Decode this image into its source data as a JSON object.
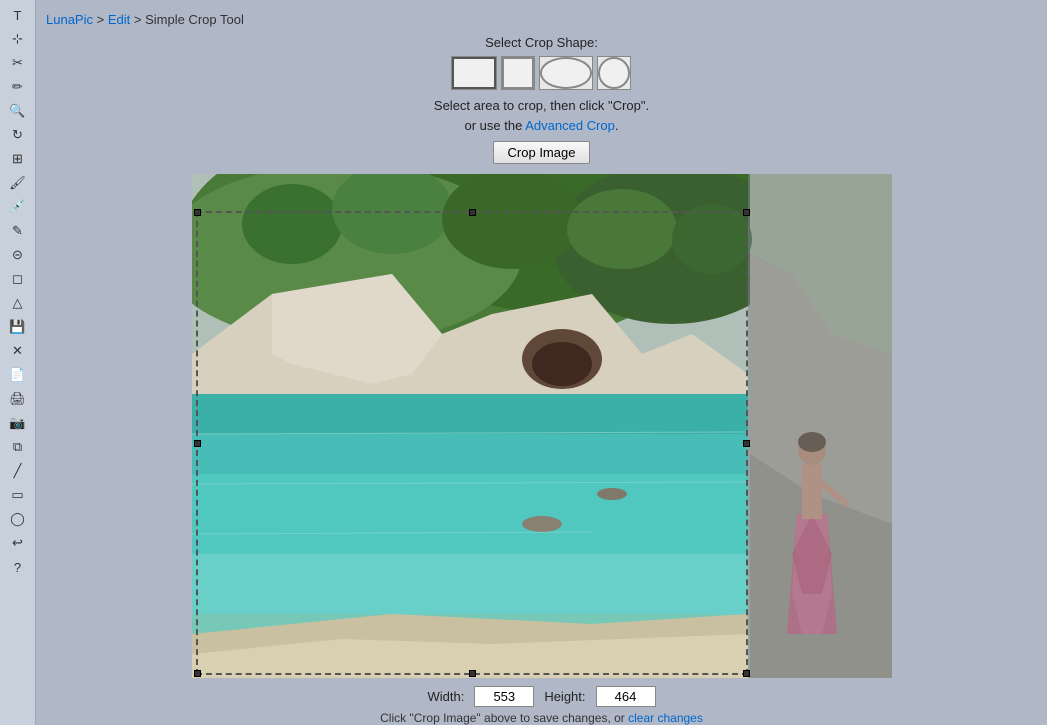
{
  "breadcrumb": {
    "luna": "LunaPic",
    "sep1": " > ",
    "edit": "Edit",
    "sep2": " > ",
    "current": "Simple Crop Tool"
  },
  "sidebar": {
    "icons": [
      {
        "name": "text-tool-icon",
        "symbol": "T"
      },
      {
        "name": "select-icon",
        "symbol": "⊹"
      },
      {
        "name": "scissors-icon",
        "symbol": "✂"
      },
      {
        "name": "pencil-icon",
        "symbol": "✏"
      },
      {
        "name": "magnify-icon",
        "symbol": "🔍"
      },
      {
        "name": "rotate-icon",
        "symbol": "↻"
      },
      {
        "name": "grid-icon",
        "symbol": "⊞"
      },
      {
        "name": "paint-icon",
        "symbol": "🖌"
      },
      {
        "name": "eyedropper-icon",
        "symbol": "💉"
      },
      {
        "name": "line-icon",
        "symbol": "/"
      },
      {
        "name": "stamp-icon",
        "symbol": "⊡"
      },
      {
        "name": "eraser-icon",
        "symbol": "◻"
      },
      {
        "name": "shape-icon",
        "symbol": "△"
      },
      {
        "name": "save-icon",
        "symbol": "💾"
      },
      {
        "name": "close-icon",
        "symbol": "✕"
      },
      {
        "name": "page-icon",
        "symbol": "📄"
      },
      {
        "name": "print-icon",
        "symbol": "🖨"
      },
      {
        "name": "camera-icon",
        "symbol": "📷"
      },
      {
        "name": "copy-icon",
        "symbol": "⧉"
      },
      {
        "name": "line-tool-icon",
        "symbol": "╱"
      },
      {
        "name": "rect-tool-icon",
        "symbol": "▭"
      },
      {
        "name": "circle-tool-icon",
        "symbol": "○"
      },
      {
        "name": "undo-icon",
        "symbol": "↩"
      },
      {
        "name": "help-icon",
        "symbol": "?"
      }
    ]
  },
  "toolbar": {
    "shape_label": "Select Crop Shape:",
    "instruction_line1": "Select area to crop, then click \"Crop\".",
    "instruction_line2": "or use the",
    "advanced_crop_label": "Advanced Crop",
    "instruction_end": ".",
    "crop_button_label": "Crop Image"
  },
  "shapes": [
    {
      "name": "rectangle",
      "label": "Rectangle"
    },
    {
      "name": "square",
      "label": "Square"
    },
    {
      "name": "oval",
      "label": "Oval"
    },
    {
      "name": "circle",
      "label": "Circle"
    }
  ],
  "image": {
    "alt": "Beach scene with cliffs and water"
  },
  "dimensions": {
    "width_label": "Width:",
    "width_value": "553",
    "height_label": "Height:",
    "height_value": "464"
  },
  "status": {
    "note_pre": "Click \"Crop Image\" above to save changes, or",
    "clear_label": "clear changes"
  }
}
